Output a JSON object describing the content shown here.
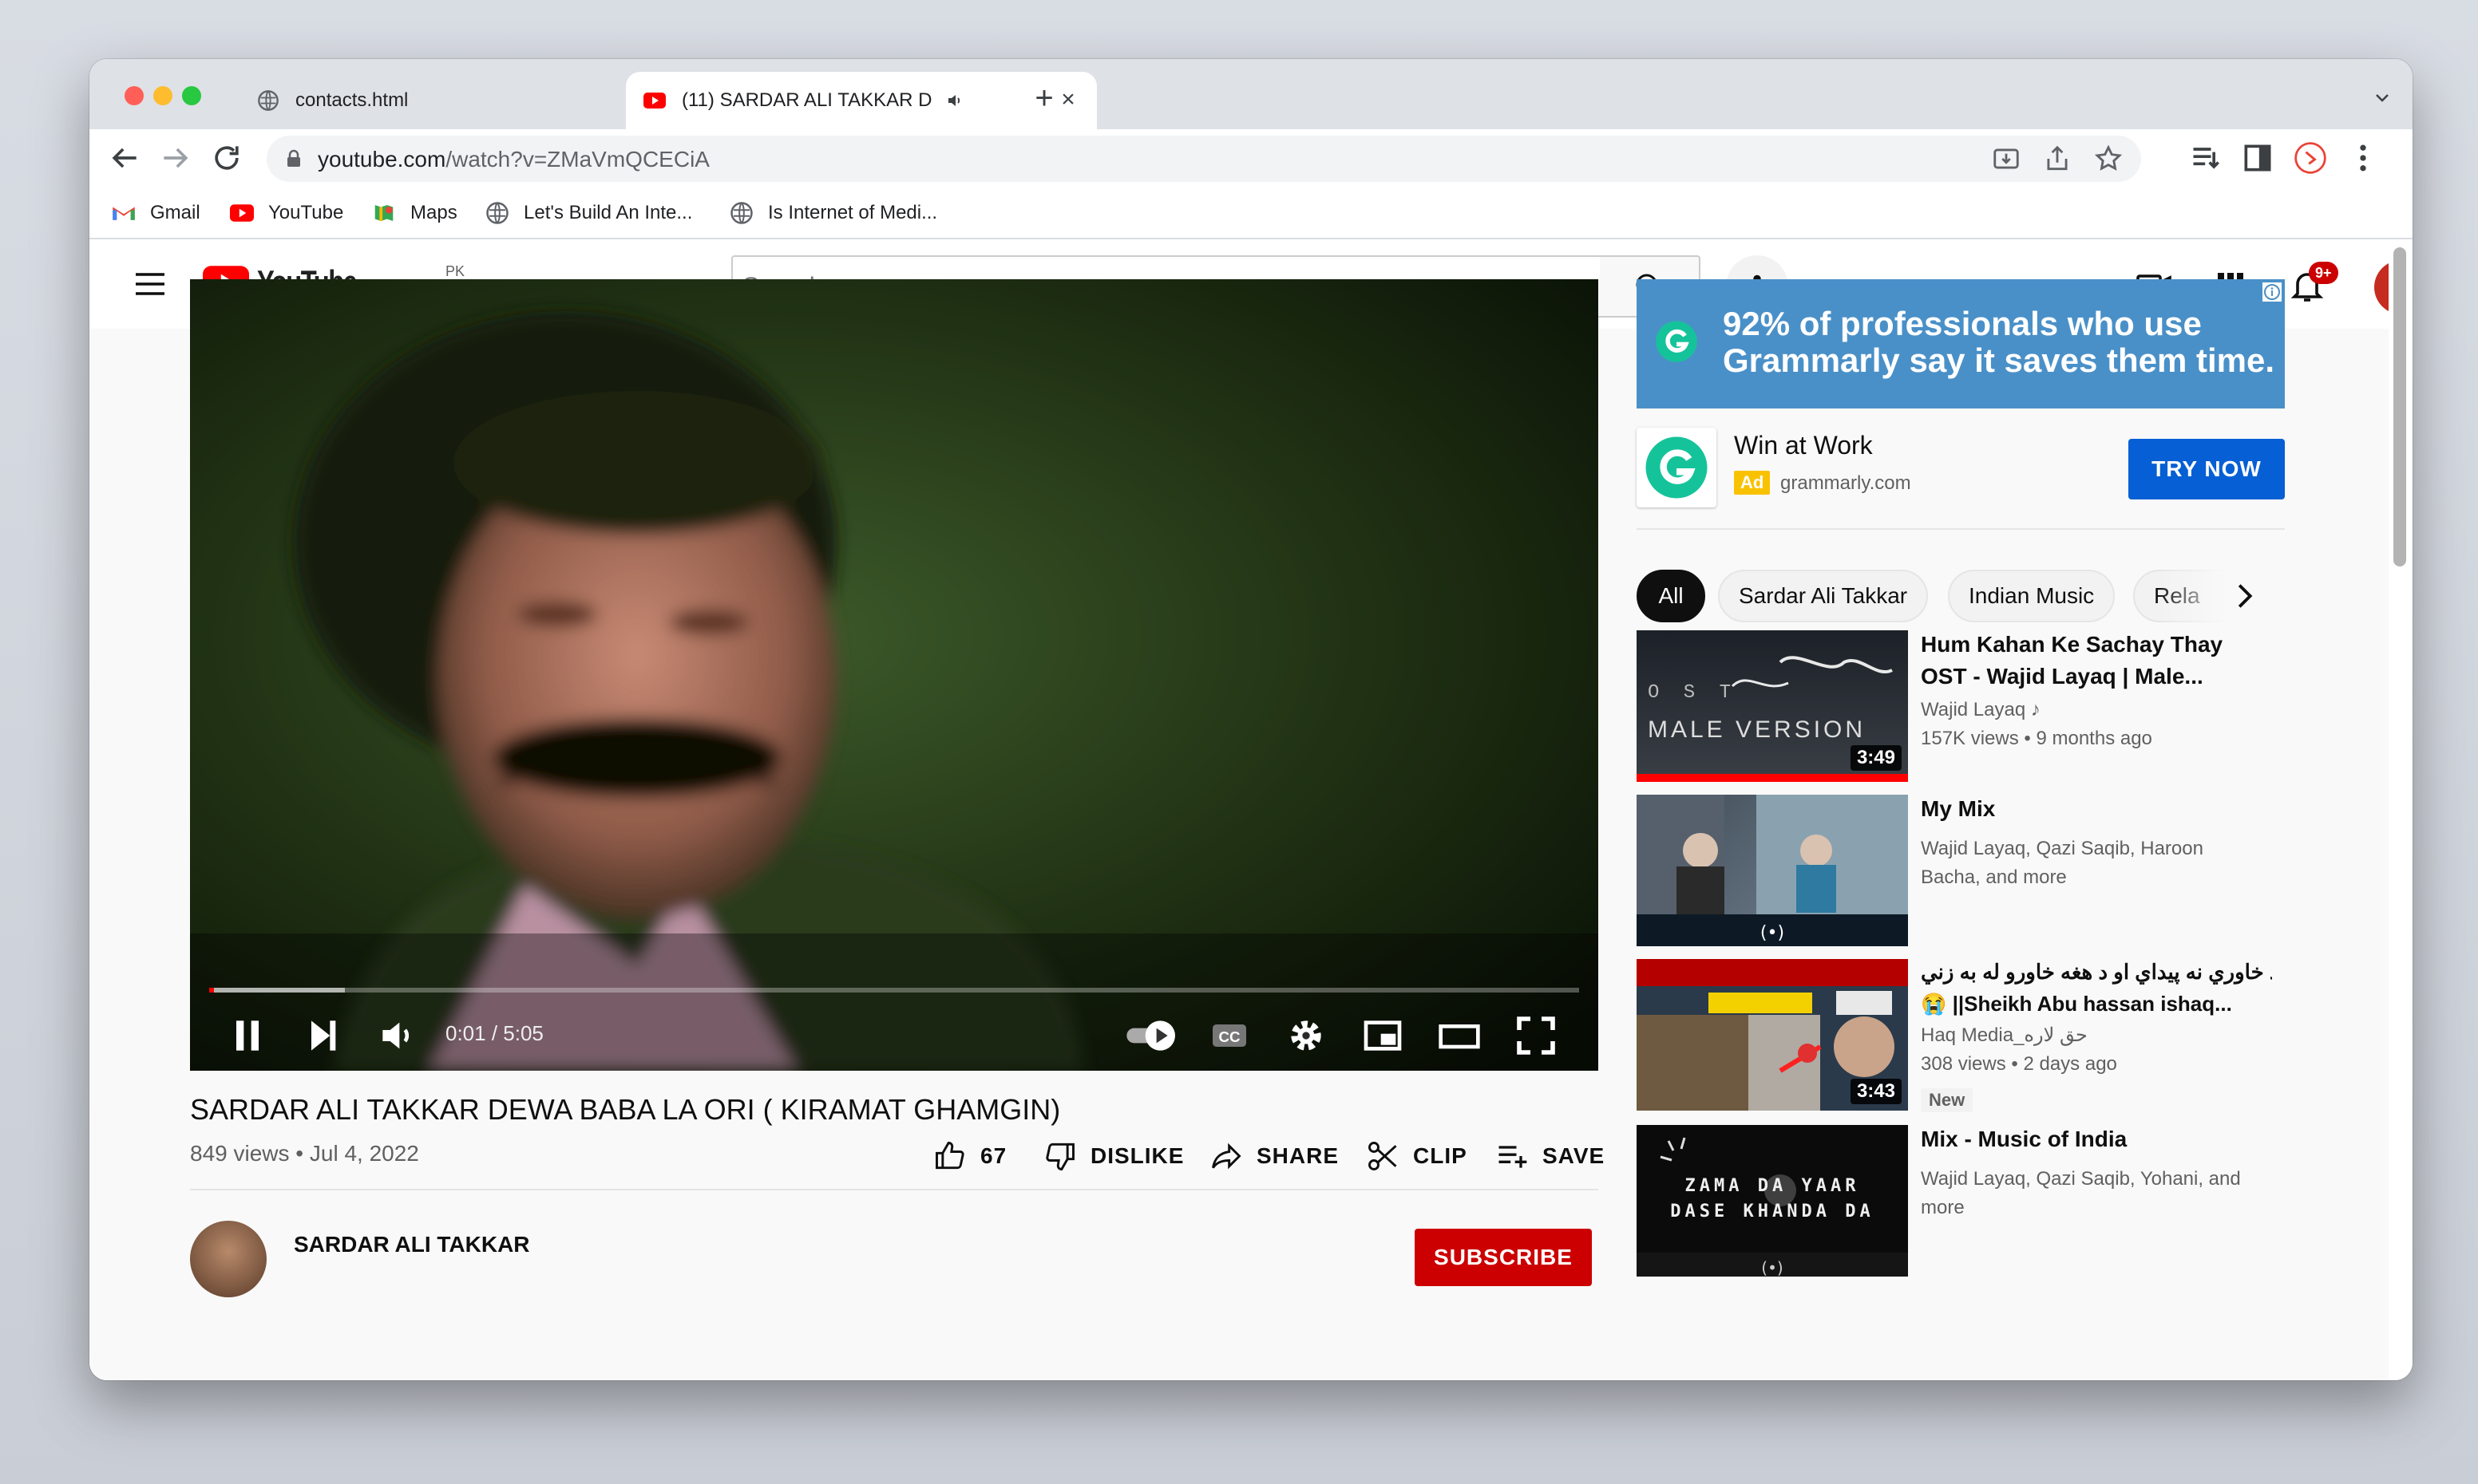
{
  "browser": {
    "tabs": [
      {
        "title": "contacts.html",
        "active": false
      },
      {
        "title": "(11) SARDAR ALI TAKKAR D",
        "active": true
      }
    ],
    "url_host": "youtube.com",
    "url_path": "/watch?v=ZMaVmQCECiA",
    "bookmarks": [
      "Gmail",
      "YouTube",
      "Maps",
      "Let's Build An Inte...",
      "Is Internet of Medi..."
    ]
  },
  "youtube": {
    "region": "PK",
    "logo_text": "YouTube",
    "search_placeholder": "Search",
    "notification_count": "9+",
    "video": {
      "title": "SARDAR ALI TAKKAR DEWA BABA LA ORI ( KIRAMAT GHAMGIN)",
      "views_date": "849 views • Jul 4, 2022",
      "time": "0:01 / 5:05",
      "progress": 0.003,
      "likes": "67",
      "dislike_label": "DISLIKE",
      "share_label": "SHARE",
      "clip_label": "CLIP",
      "save_label": "SAVE",
      "channel_name": "SARDAR ALI TAKKAR",
      "subscribe_label": "SUBSCRIBE"
    },
    "ad": {
      "banner_line1": "92% of professionals who use",
      "banner_line2": "Grammarly say it saves them time.",
      "title": "Win at Work",
      "badge": "Ad",
      "domain": "grammarly.com",
      "cta": "TRY NOW"
    },
    "chips": [
      "All",
      "Sardar Ali Takkar",
      "Indian Music",
      "Rela"
    ],
    "related": [
      {
        "title1": "Hum Kahan Ke Sachay Thay",
        "title2": "OST - Wajid Layaq | Male...",
        "channel": "Wajid Layaq ♪",
        "meta": "157K views • 9 months ago",
        "duration": "3:49",
        "thumb_text": "MALE VERSION"
      },
      {
        "title1": "My Mix",
        "meta1": "Wajid Layaq, Qazi Saqib, Haroon",
        "meta2": "Bacha, and more"
      },
      {
        "title1": "د خاوري نه پيداي او د هغه خاورو له به زني",
        "title2": "😭 ||Sheikh Abu hassan ishaq...",
        "channel": "Haq Media_حق لاره",
        "meta": "308 views • 2 days ago",
        "badge": "New",
        "duration": "3:43"
      },
      {
        "title1": "Mix - Music of India",
        "meta1": "Wajid Layaq, Qazi Saqib, Yohani, and",
        "meta2": "more",
        "thumb_line1": "ZAMA DA YAAR",
        "thumb_line2": "DASE KHANDA DA"
      }
    ]
  },
  "colors": {
    "yt_red": "#ff0000",
    "subscribe": "#cc0000",
    "cta_blue": "#065fd4",
    "ad_banner": "#4a90c8"
  }
}
